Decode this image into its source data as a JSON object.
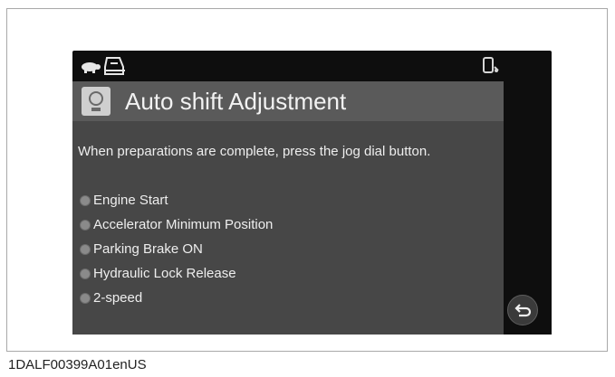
{
  "screen": {
    "title": "Auto shift Adjustment",
    "instruction": "When preparations are complete, press the jog dial button.",
    "checklist": [
      "Engine Start",
      "Accelerator Minimum Position",
      "Parking Brake ON",
      "Hydraulic Lock Release",
      "2-speed"
    ]
  },
  "icons": {
    "top_left_1": "turtle-icon",
    "top_left_2": "operator-cab-icon",
    "top_right": "device-status-icon",
    "title": "auto-shift-icon",
    "bottom_right": "return-icon"
  },
  "footer": {
    "figure_id": "1DALF00399A01enUS"
  },
  "colors": {
    "screen_bg": "#0e0e0e",
    "panel_bg": "#474747",
    "titlebar_bg": "#5a5a5a",
    "text": "#eeeeee"
  }
}
